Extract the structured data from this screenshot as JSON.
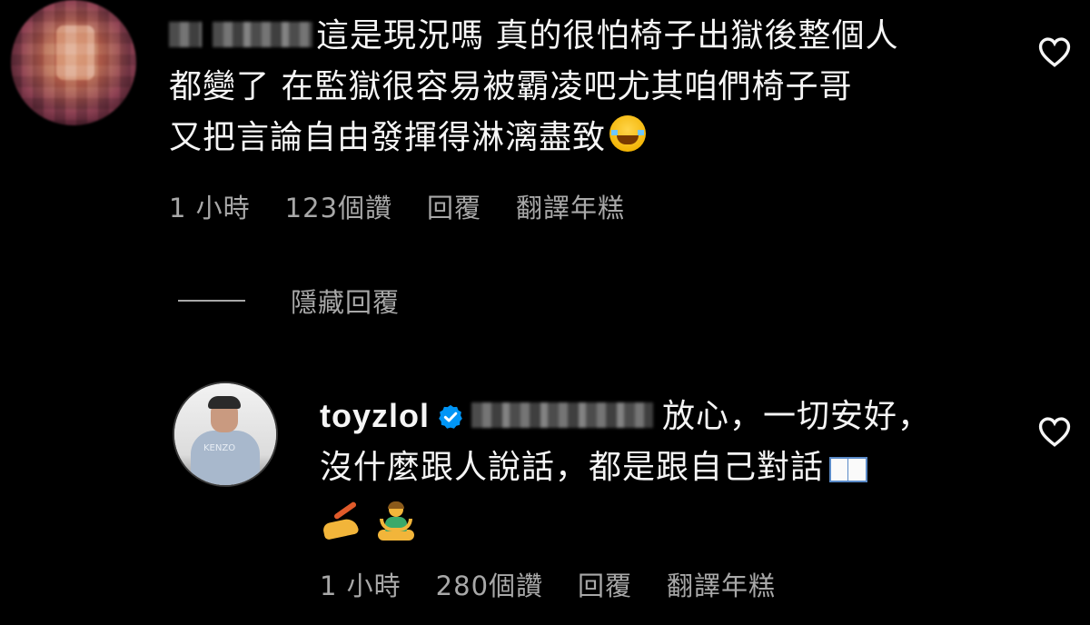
{
  "comment_1": {
    "text_line1": "這是現況嗎 真的很怕椅子出獄後整個人",
    "text_line2": "都變了 在監獄很容易被霸凌吧尤其咱們椅子哥",
    "text_line3": "又把言論自由發揮得淋漓盡致",
    "emoji": "face-with-tears-of-joy",
    "meta": {
      "time": "1 小時",
      "likes": "123個讚",
      "reply": "回覆",
      "translate": "翻譯年糕"
    }
  },
  "hidden_replies": {
    "label": "隱藏回覆"
  },
  "reply_1": {
    "username": "toyzlol",
    "verified": true,
    "text_line1": "放心，一切安好，",
    "text_line2": "沒什麼跟人說話，都是跟自己對話",
    "emojis": [
      "open-book",
      "writing-hand",
      "person-in-lotus-position"
    ],
    "meta": {
      "time": "1 小時",
      "likes": "280個讚",
      "reply": "回覆",
      "translate": "翻譯年糕"
    },
    "avatar_text": "KENZO"
  },
  "icons": {
    "heart": "heart-outline-icon",
    "verified": "verified-badge-icon"
  },
  "colors": {
    "background": "#000000",
    "text_primary": "#f5f5f5",
    "text_secondary": "#a8a8a8",
    "verified_blue": "#0095f6"
  }
}
